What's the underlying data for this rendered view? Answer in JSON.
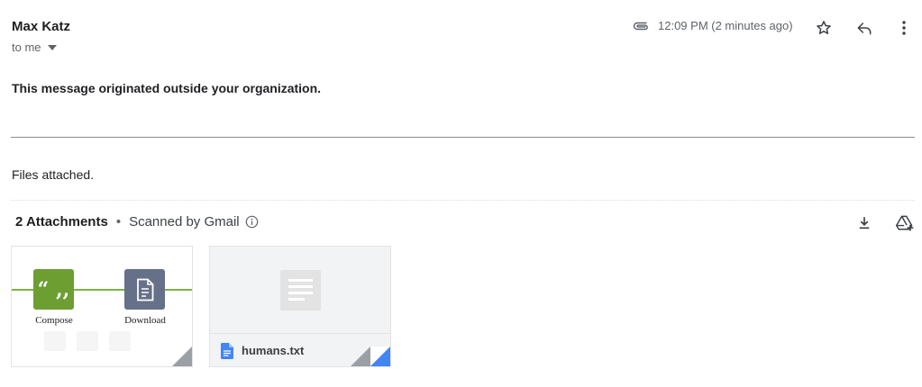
{
  "header": {
    "sender": "Max Katz",
    "recipient": "to me",
    "time": "12:09 PM (2 minutes ago)"
  },
  "warning": "This message originated outside your organization.",
  "body": "Files attached.",
  "attachments": {
    "count_label": "2 Attachments",
    "separator": "•",
    "scanned_label": "Scanned by Gmail",
    "items": [
      {
        "labels": [
          "Compose",
          "Download"
        ]
      },
      {
        "filename": "humans.txt"
      }
    ]
  },
  "colors": {
    "compose_tile": "#6d9e32",
    "download_tile": "#677089",
    "docs_blue": "#4285f4",
    "green_line": "#7cb342"
  }
}
